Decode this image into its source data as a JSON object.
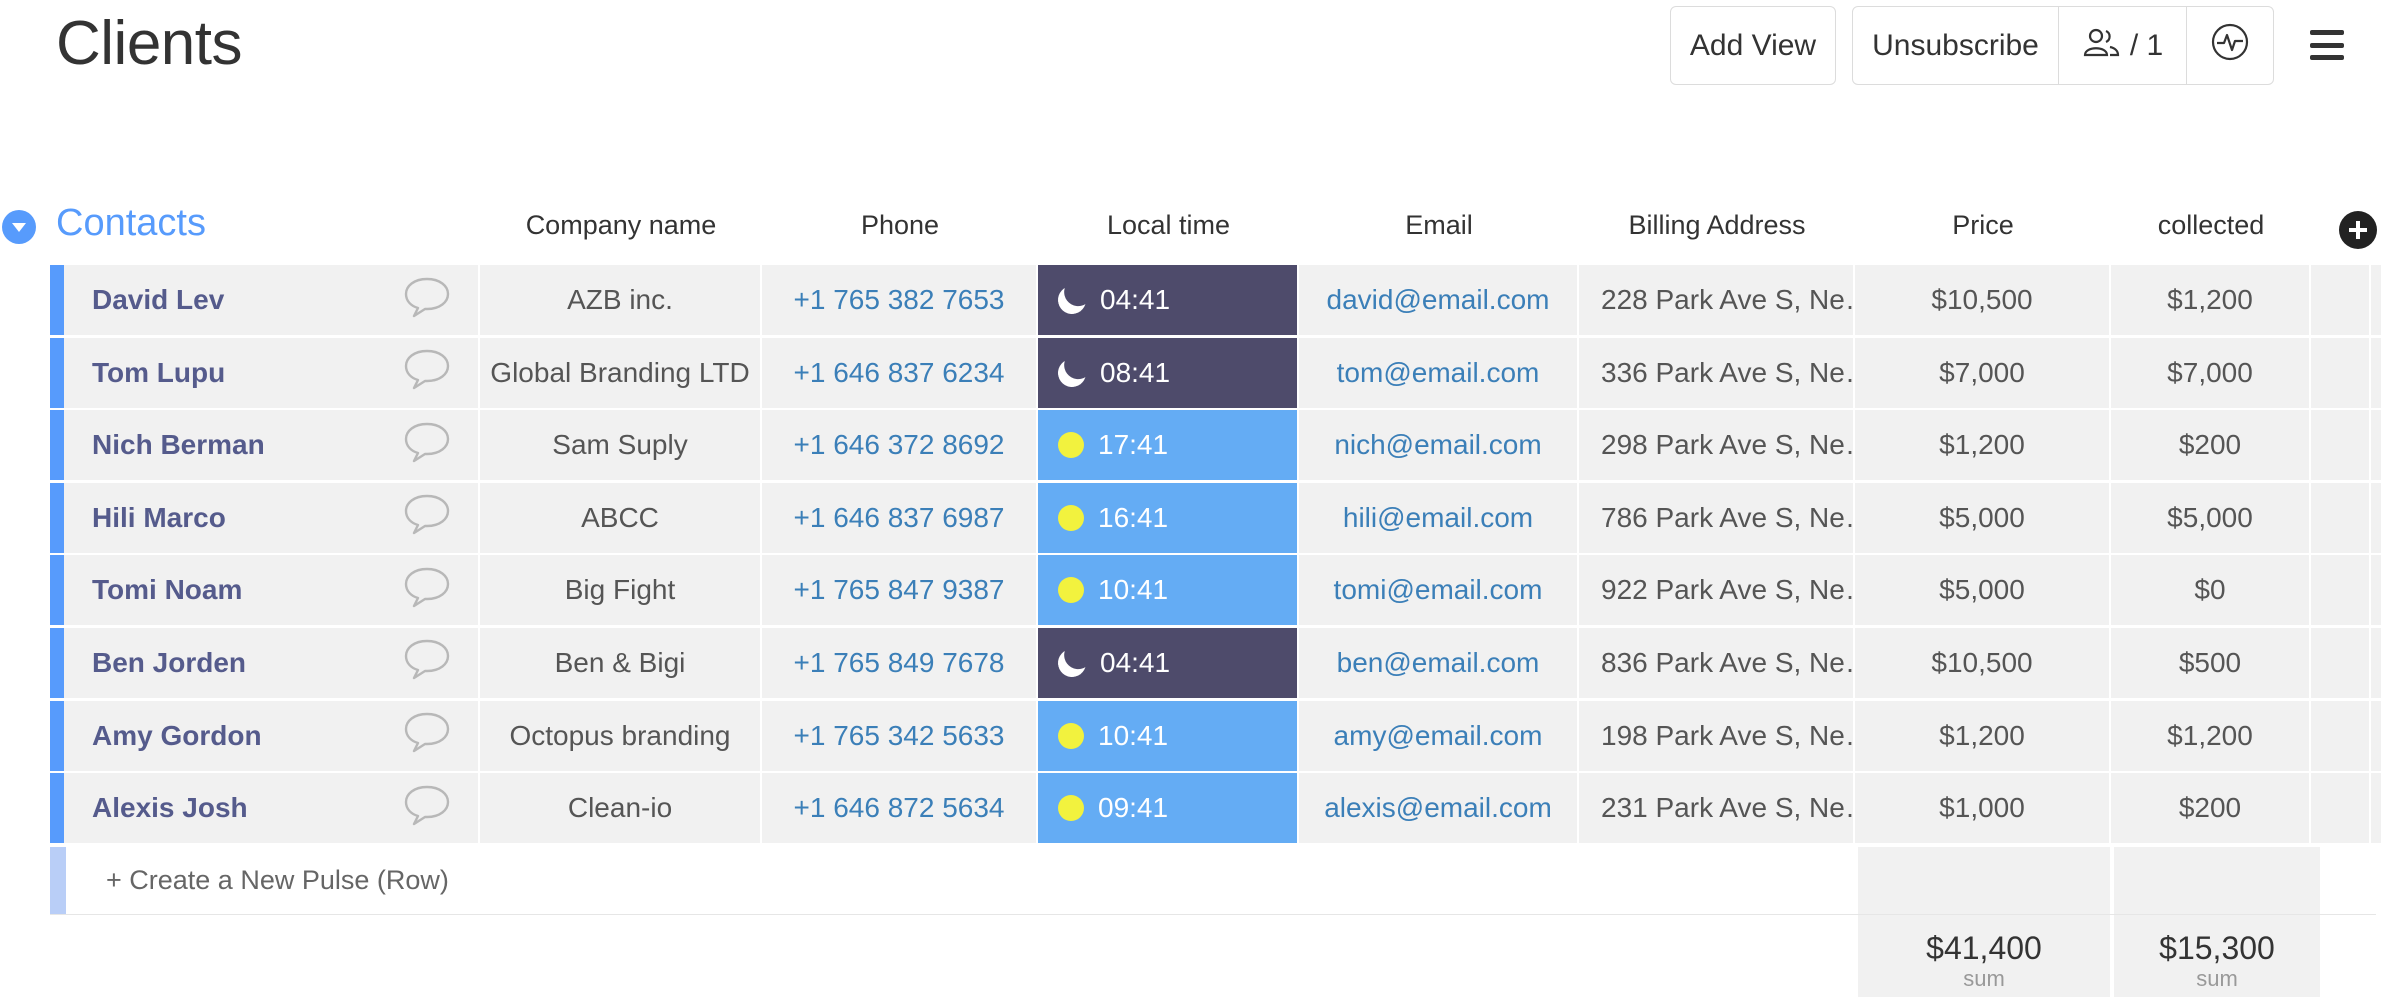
{
  "page": {
    "title": "Clients"
  },
  "header": {
    "add_view_label": "Add View",
    "unsubscribe_label": "Unsubscribe",
    "subscribers_count": "/ 1"
  },
  "group": {
    "title": "Contacts",
    "accent": "#579bfc",
    "columns": {
      "company": "Company name",
      "phone": "Phone",
      "local_time": "Local time",
      "email": "Email",
      "billing": "Billing Address",
      "price": "Price",
      "collected": "collected"
    },
    "rows": [
      {
        "name": "David Lev",
        "company": "AZB inc.",
        "phone": "+1 765 382 7653",
        "time": "04:41",
        "period": "night",
        "email": "david@email.com",
        "address": "228 Park Ave S, Ne…",
        "price": "$10,500",
        "collected": "$1,200"
      },
      {
        "name": "Tom Lupu",
        "company": "Global Branding LTD",
        "phone": "+1 646 837 6234",
        "time": "08:41",
        "period": "night",
        "email": "tom@email.com",
        "address": "336 Park Ave S, Ne…",
        "price": "$7,000",
        "collected": "$7,000"
      },
      {
        "name": "Nich Berman",
        "company": "Sam Suply",
        "phone": "+1 646 372 8692",
        "time": "17:41",
        "period": "day",
        "email": "nich@email.com",
        "address": "298 Park Ave S, Ne…",
        "price": "$1,200",
        "collected": "$200"
      },
      {
        "name": "Hili Marco",
        "company": "ABCC",
        "phone": "+1 646 837 6987",
        "time": "16:41",
        "period": "day",
        "email": "hili@email.com",
        "address": "786 Park Ave S, Ne…",
        "price": "$5,000",
        "collected": "$5,000"
      },
      {
        "name": "Tomi Noam",
        "company": "Big Fight",
        "phone": "+1 765 847 9387",
        "time": "10:41",
        "period": "day",
        "email": "tomi@email.com",
        "address": "922 Park Ave S, Ne…",
        "price": "$5,000",
        "collected": "$0"
      },
      {
        "name": "Ben Jorden",
        "company": "Ben & Bigi",
        "phone": "+1 765 849 7678",
        "time": "04:41",
        "period": "night",
        "email": "ben@email.com",
        "address": "836 Park Ave S, Ne…",
        "price": "$10,500",
        "collected": "$500"
      },
      {
        "name": "Amy Gordon",
        "company": "Octopus branding",
        "phone": "+1 765 342 5633",
        "time": "10:41",
        "period": "day",
        "email": "amy@email.com",
        "address": "198 Park Ave S, Ne…",
        "price": "$1,200",
        "collected": "$1,200"
      },
      {
        "name": "Alexis Josh",
        "company": "Clean-io",
        "phone": "+1 646 872 5634",
        "time": "09:41",
        "period": "day",
        "email": "alexis@email.com",
        "address": "231 Park Ave S, Ne…",
        "price": "$1,000",
        "collected": "$200"
      }
    ],
    "new_row_label": "+ Create a New Pulse (Row)",
    "sums": {
      "price": "$41,400",
      "collected": "$15,300",
      "label": "sum"
    }
  },
  "colors": {
    "night": "#4e4b6b",
    "day": "#64acf4",
    "sun": "#f2f23e",
    "link": "#3b7fb8"
  }
}
